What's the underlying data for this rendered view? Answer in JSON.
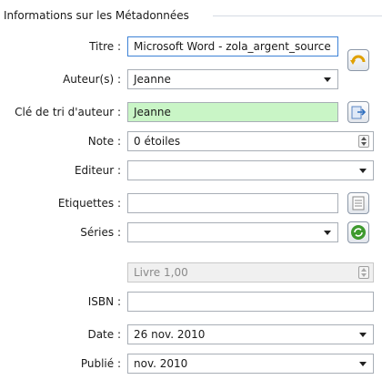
{
  "group": {
    "title": "Informations sur les Métadonnées"
  },
  "fields": {
    "title": {
      "label": "Titre :",
      "value": "Microsoft Word - zola_argent_source"
    },
    "authors": {
      "label": "Auteur(s) :",
      "value": "Jeanne"
    },
    "author_sort": {
      "label": "Clé de tri d'auteur :",
      "value": "Jeanne",
      "color": "#c9f5c6"
    },
    "rating": {
      "label": "Note :",
      "value": "0 étoiles"
    },
    "publisher": {
      "label": "Editeur :",
      "value": ""
    },
    "tags": {
      "label": "Etiquettes :",
      "value": ""
    },
    "series": {
      "label": "Séries :",
      "value": ""
    },
    "series_index": {
      "value": "Livre 1,00"
    },
    "isbn": {
      "label": "ISBN :",
      "value": ""
    },
    "date": {
      "label": "Date :",
      "value": "26 nov. 2010"
    },
    "published": {
      "label": "Publié :",
      "value": "nov. 2010"
    }
  },
  "icons": {
    "swap": "swap-title-author-icon",
    "author_sort": "generate-author-sort-icon",
    "tags": "tag-editor-icon",
    "series": "remove-unused-series-icon"
  }
}
